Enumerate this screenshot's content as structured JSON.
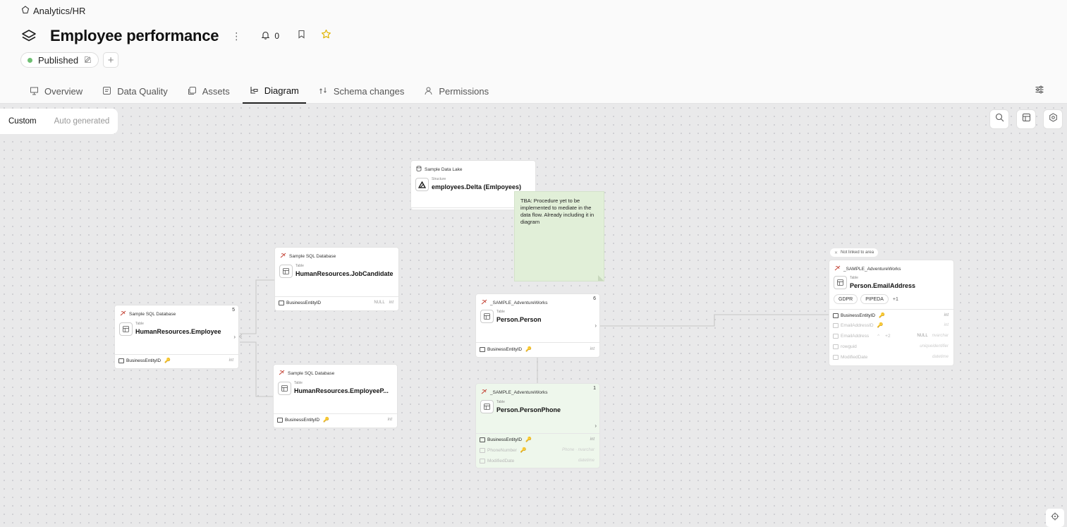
{
  "breadcrumb": "Analytics/HR",
  "page": {
    "title": "Employee performance",
    "notification_count": "0"
  },
  "status": {
    "label": "Published"
  },
  "tabs": [
    {
      "label": "Overview"
    },
    {
      "label": "Data Quality"
    },
    {
      "label": "Assets"
    },
    {
      "label": "Diagram"
    },
    {
      "label": "Schema changes"
    },
    {
      "label": "Permissions"
    }
  ],
  "mode": {
    "custom": "Custom",
    "auto": "Auto generated"
  },
  "colors": {
    "accent": "#222222",
    "status": "#6fbf73",
    "note_bg": "#e1efd8",
    "node_green": "#eef7ec"
  },
  "nodes": {
    "datalake": {
      "source": "Sample Data Lake",
      "kind": "Structure",
      "name": "employees.Delta (Emlpoyees)"
    },
    "employee": {
      "source": "Sample SQL Database",
      "count": "5",
      "kind": "Table",
      "name": "HumanResources.Employee",
      "columns": [
        {
          "name": "BusinessEntityID",
          "type": "int"
        }
      ]
    },
    "jobcandidate": {
      "source": "Sample SQL Database",
      "kind": "Table",
      "name": "HumanResources.JobCandidate",
      "columns": [
        {
          "name": "BusinessEntityID",
          "null": "NULL",
          "type": "int"
        }
      ]
    },
    "employeepay": {
      "source": "Sample SQL Database",
      "kind": "Table",
      "name": "HumanResources.EmployeeP...",
      "columns": [
        {
          "name": "BusinessEntityID",
          "type": "int"
        }
      ]
    },
    "person": {
      "source": "_SAMPLE_AdventureWorks",
      "count": "6",
      "kind": "Table",
      "name": "Person.Person",
      "columns": [
        {
          "name": "BusinessEntityID",
          "type": "int"
        }
      ]
    },
    "personphone": {
      "source": "_SAMPLE_AdventureWorks",
      "count": "1",
      "kind": "Table",
      "name": "Person.PersonPhone",
      "columns": [
        {
          "name": "BusinessEntityID",
          "type": "int"
        },
        {
          "name": "PhoneNumber",
          "type": "Phone · nvarchar"
        },
        {
          "name": "ModifiedDate",
          "type": "datetime"
        }
      ]
    },
    "email": {
      "source": "_SAMPLE_AdventureWorks",
      "kind": "Table",
      "name": "Person.EmailAddress",
      "tags": [
        "GDPR",
        "PIPEDA"
      ],
      "tags_more": "+1",
      "badge": "Not linked to area",
      "columns": [
        {
          "name": "BusinessEntityID",
          "type": "int"
        },
        {
          "name": "EmailAddressID",
          "type": "int"
        },
        {
          "name": "EmailAddress",
          "extra": "+2",
          "null": "NULL",
          "type": "nvarchar"
        },
        {
          "name": "rowguid",
          "type": "uniqueidentifier"
        },
        {
          "name": "ModifiedDate",
          "type": "datetime"
        }
      ]
    }
  },
  "note": {
    "text": "TBA: Procedure yet to be implemented to mediate in the data flow. Already including it in diagram"
  }
}
